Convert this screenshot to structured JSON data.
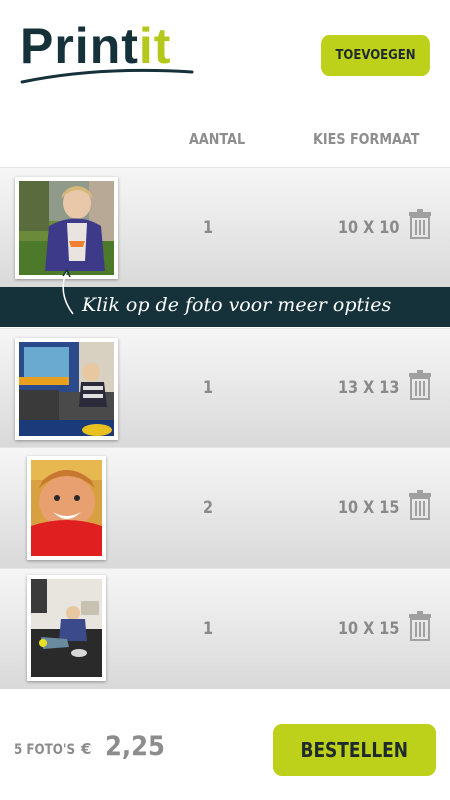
{
  "header": {
    "logo_main": "Print",
    "logo_accent": "it",
    "add_button": "TOEVOEGEN"
  },
  "columns": {
    "quantity": "AANTAL",
    "format": "KIES FORMAAT"
  },
  "tip": {
    "text": "Klik op de foto voor meer opties"
  },
  "photos": [
    {
      "quantity": "1",
      "format": "10 X 10"
    },
    {
      "quantity": "1",
      "format": "13 X 13"
    },
    {
      "quantity": "2",
      "format": "10 X 15"
    },
    {
      "quantity": "1",
      "format": "10 X 15"
    }
  ],
  "footer": {
    "count": "5 FOTO'S",
    "currency": "€",
    "price": "2,25",
    "order_button": "BESTELLEN"
  },
  "colors": {
    "accent": "#bdd11a",
    "dark": "#15313a",
    "text_gray": "#8a8a8a"
  }
}
